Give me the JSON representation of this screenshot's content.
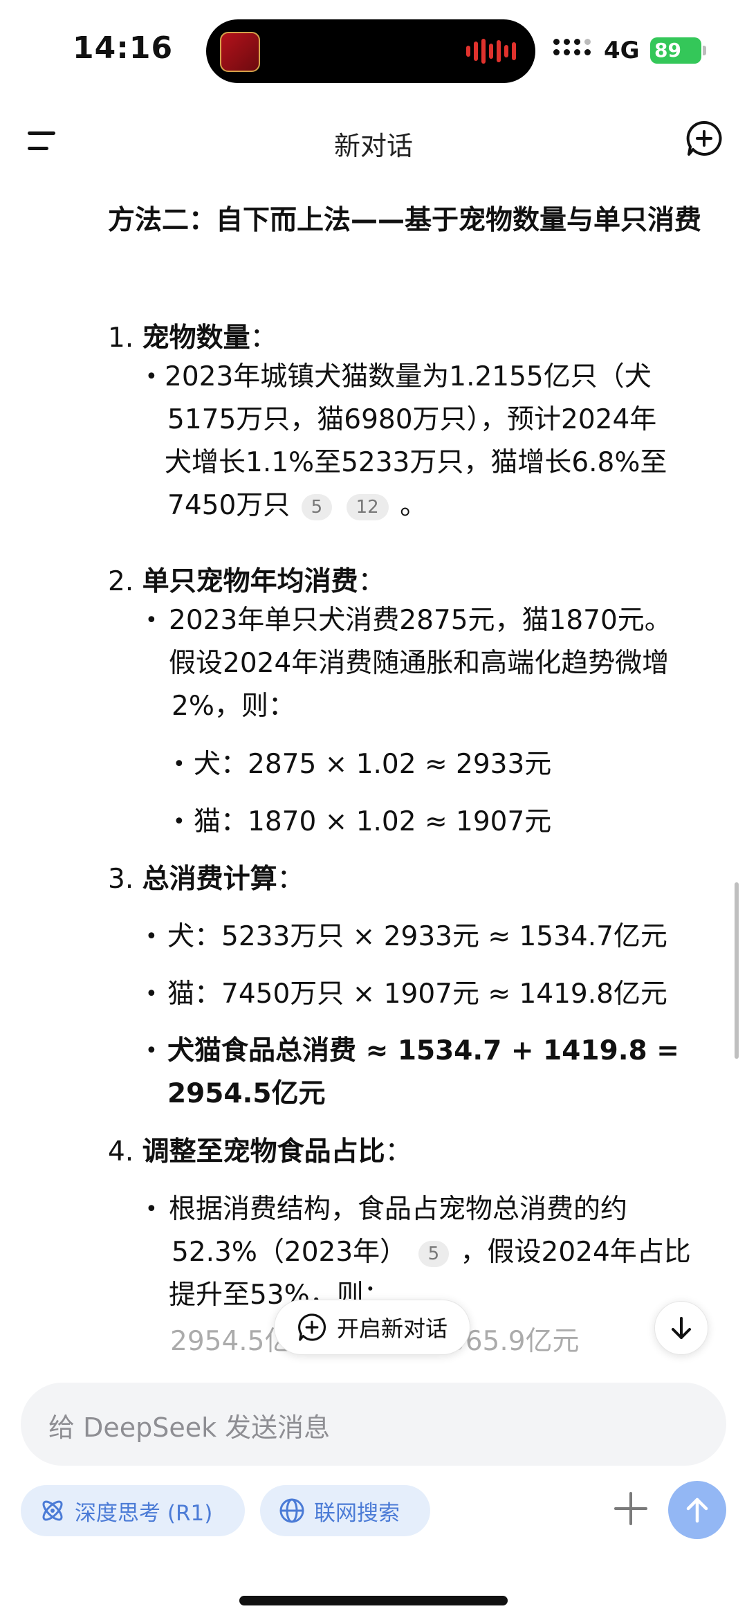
{
  "status_bar": {
    "time": "14:16",
    "network": "4G",
    "battery": "89"
  },
  "nav": {
    "title": "新对话"
  },
  "content": {
    "heading": "方法二：自下而上法——基于宠物数量与单只消费",
    "sections": [
      {
        "number": "1.",
        "title": "宠物数量",
        "colon": "：",
        "bullets": [
          {
            "lines": [
              "2023年城镇犬猫数量为1.2155亿只（犬",
              "5175万只，猫6980万只），预计2024年",
              "犬增长1.1%至5233万只，猫增长6.8%至",
              "7450万只"
            ],
            "citations": [
              "5",
              "12"
            ],
            "tail": "。"
          }
        ]
      },
      {
        "number": "2.",
        "title": "单只宠物年均消费",
        "colon": "：",
        "bullets": [
          {
            "lines": [
              "2023年单只犬消费2875元，猫1870元。",
              "假设2024年消费随通胀和高端化趋势微增",
              "2%，则："
            ],
            "sub_bullets": [
              "犬：2875 × 1.02 ≈ 2933元",
              "猫：1870 × 1.02 ≈ 1907元"
            ]
          }
        ]
      },
      {
        "number": "3.",
        "title": "总消费计算",
        "colon": "：",
        "bullets": [
          {
            "lines": [
              "犬：5233万只 × 2933元 ≈ 1534.7亿元"
            ]
          },
          {
            "lines": [
              "猫：7450万只 × 1907元 ≈ 1419.8亿元"
            ]
          },
          {
            "lines": [
              "犬猫食品总消费 ≈ 1534.7 + 1419.8 =",
              "2954.5亿元"
            ],
            "bold": true
          }
        ]
      },
      {
        "number": "4.",
        "title": "调整至宠物食品占比",
        "colon": "：",
        "bullets": [
          {
            "lines": [
              "根据消费结构，食品占宠物总消费的约",
              "52.3%（2023年）",
              "，假设2024年占比",
              "提升至53%，则："
            ],
            "citations": [
              "5"
            ],
            "faded_line": "2954.5亿 × 53% ≈ 1565.9亿元"
          }
        ]
      }
    ]
  },
  "floating": {
    "new_chat_label": "开启新对话"
  },
  "composer": {
    "placeholder": "给 DeepSeek 发送消息",
    "deep_think_label": "深度思考 (R1)",
    "web_search_label": "联网搜索"
  },
  "icons": {
    "menu": "menu-icon",
    "new_chat": "new-chat-icon",
    "scroll_down": "arrow-down-icon",
    "deep_think": "atom-icon",
    "web_search": "globe-icon",
    "attach": "plus-icon",
    "send": "arrow-up-icon"
  },
  "colors": {
    "accent": "#4b7bd6",
    "chip_bg": "#e5eefb",
    "send_bg": "#93b7f4",
    "battery": "#34c759"
  }
}
